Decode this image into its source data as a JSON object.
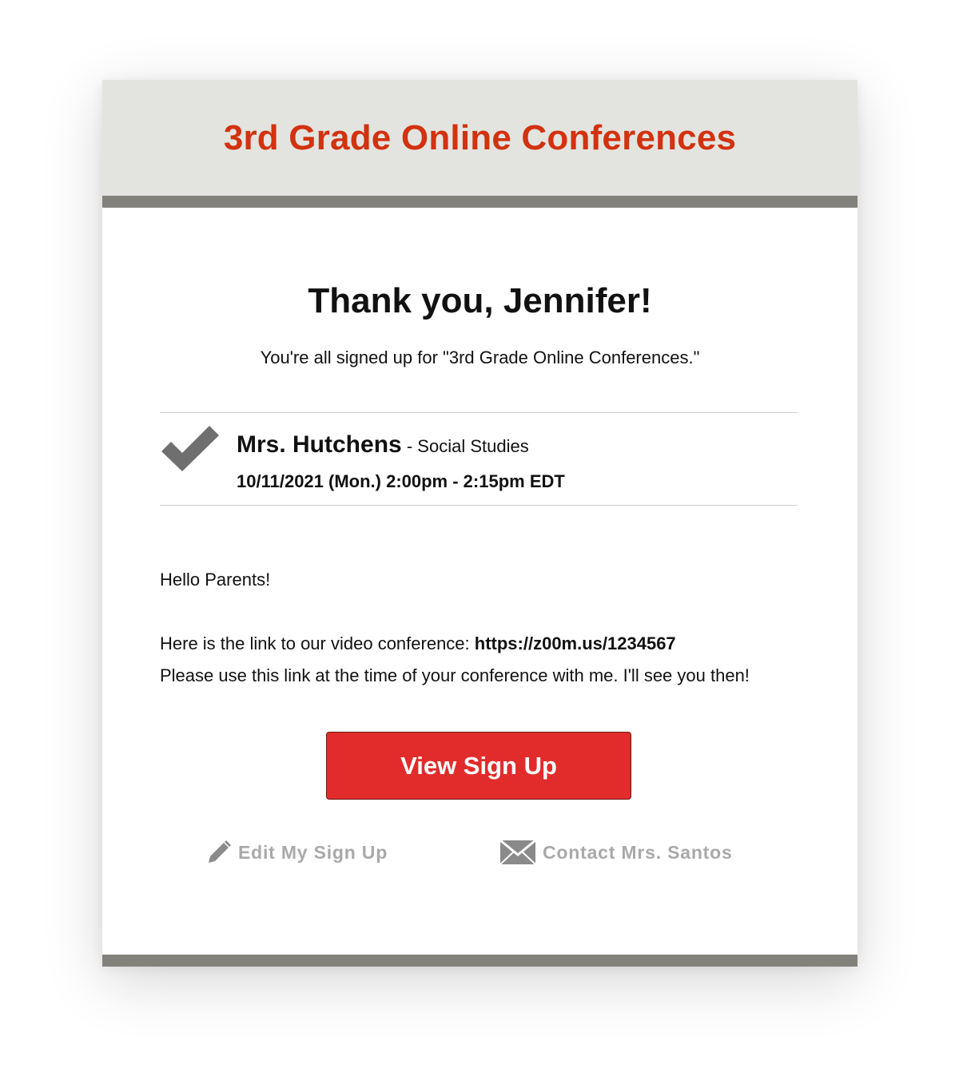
{
  "header": {
    "title": "3rd Grade Online Conferences"
  },
  "confirmation": {
    "heading": "Thank you, Jennifer!",
    "subtitle": "You're all signed up for \"3rd Grade Online Conferences.\""
  },
  "slot": {
    "teacher": "Mrs. Hutchens",
    "separator": " - ",
    "subject": "Social Studies",
    "datetime": "10/11/2021 (Mon.) 2:00pm - 2:15pm EDT",
    "status_icon": "checkmark-icon"
  },
  "message": {
    "greeting": "Hello Parents!",
    "link_prefix": "Here is the link to our video conference: ",
    "link_url": "https://z00m.us/1234567",
    "instructions": "Please use this link at the time of your conference with me. I'll see you then!"
  },
  "actions": {
    "view_label": "View Sign Up",
    "edit_label": "Edit My Sign Up",
    "edit_icon": "pencil-icon",
    "contact_label": "Contact Mrs. Santos",
    "contact_icon": "envelope-icon"
  },
  "colors": {
    "brand_red": "#d2320f",
    "button_red": "#e12c2b",
    "header_bg": "#e3e4e0",
    "bar_gray": "#82827a",
    "check_gray": "#6f6f6f",
    "link_gray": "#a9a9a9"
  }
}
